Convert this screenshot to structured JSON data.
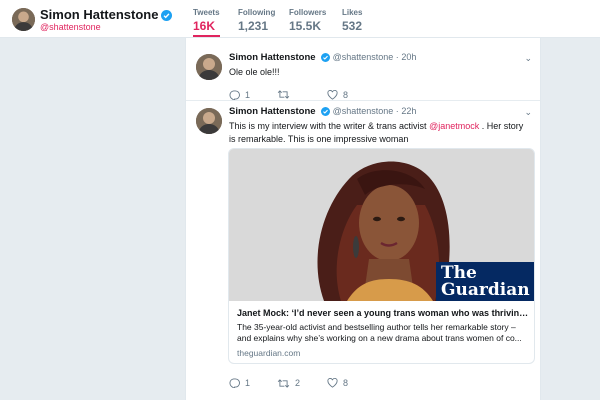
{
  "profile": {
    "name": "Simon Hattenstone",
    "handle": "@shattenstone"
  },
  "stats": [
    {
      "label": "Tweets",
      "value": "16K",
      "active": true
    },
    {
      "label": "Following",
      "value": "1,231"
    },
    {
      "label": "Followers",
      "value": "15.5K"
    },
    {
      "label": "Likes",
      "value": "532"
    }
  ],
  "tweets": [
    {
      "name": "Simon Hattenstone",
      "handle": "@shattenstone",
      "time": "20h",
      "text": "Ole ole ole!!!",
      "replies": "1",
      "retweets": "",
      "likes": "8"
    },
    {
      "name": "Simon Hattenstone",
      "handle": "@shattenstone",
      "time": "22h",
      "text_before": "This is my interview with the writer & trans activist ",
      "mention": "@janetmock",
      "text_after": " . Her story is remarkable. This is one impressive woman",
      "card": {
        "logo_line1": "The",
        "logo_line2": "Guardian",
        "title": "Janet Mock: ‘I’d never seen a young trans woman who was thriving i...",
        "description": "The 35-year-old activist and bestselling author tells her remarkable story – and explains why she’s working on a new drama about trans women of co...",
        "domain": "theguardian.com"
      },
      "replies": "1",
      "retweets": "2",
      "likes": "8"
    }
  ],
  "sep": "·",
  "colors": {
    "accent": "#e0245e",
    "verified": "#1da1f2",
    "guardian_blue": "#052962"
  }
}
